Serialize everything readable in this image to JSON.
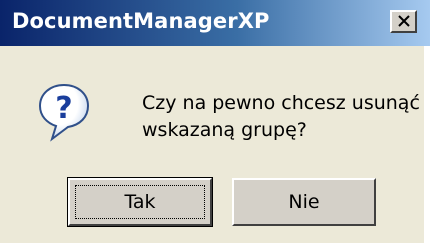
{
  "dialog": {
    "title": "DocumentManagerXP",
    "message_line1": "Czy na pewno chcesz usunąć",
    "message_line2": "wskazaną grupę?",
    "icon": "question-icon",
    "buttons": {
      "yes_label": "Tak",
      "no_label": "Nie"
    }
  },
  "colors": {
    "title_bar_start": "#0a246a",
    "title_bar_end": "#a6caf0",
    "dialog_face": "#ece9d8",
    "button_face": "#d4d0c8"
  }
}
